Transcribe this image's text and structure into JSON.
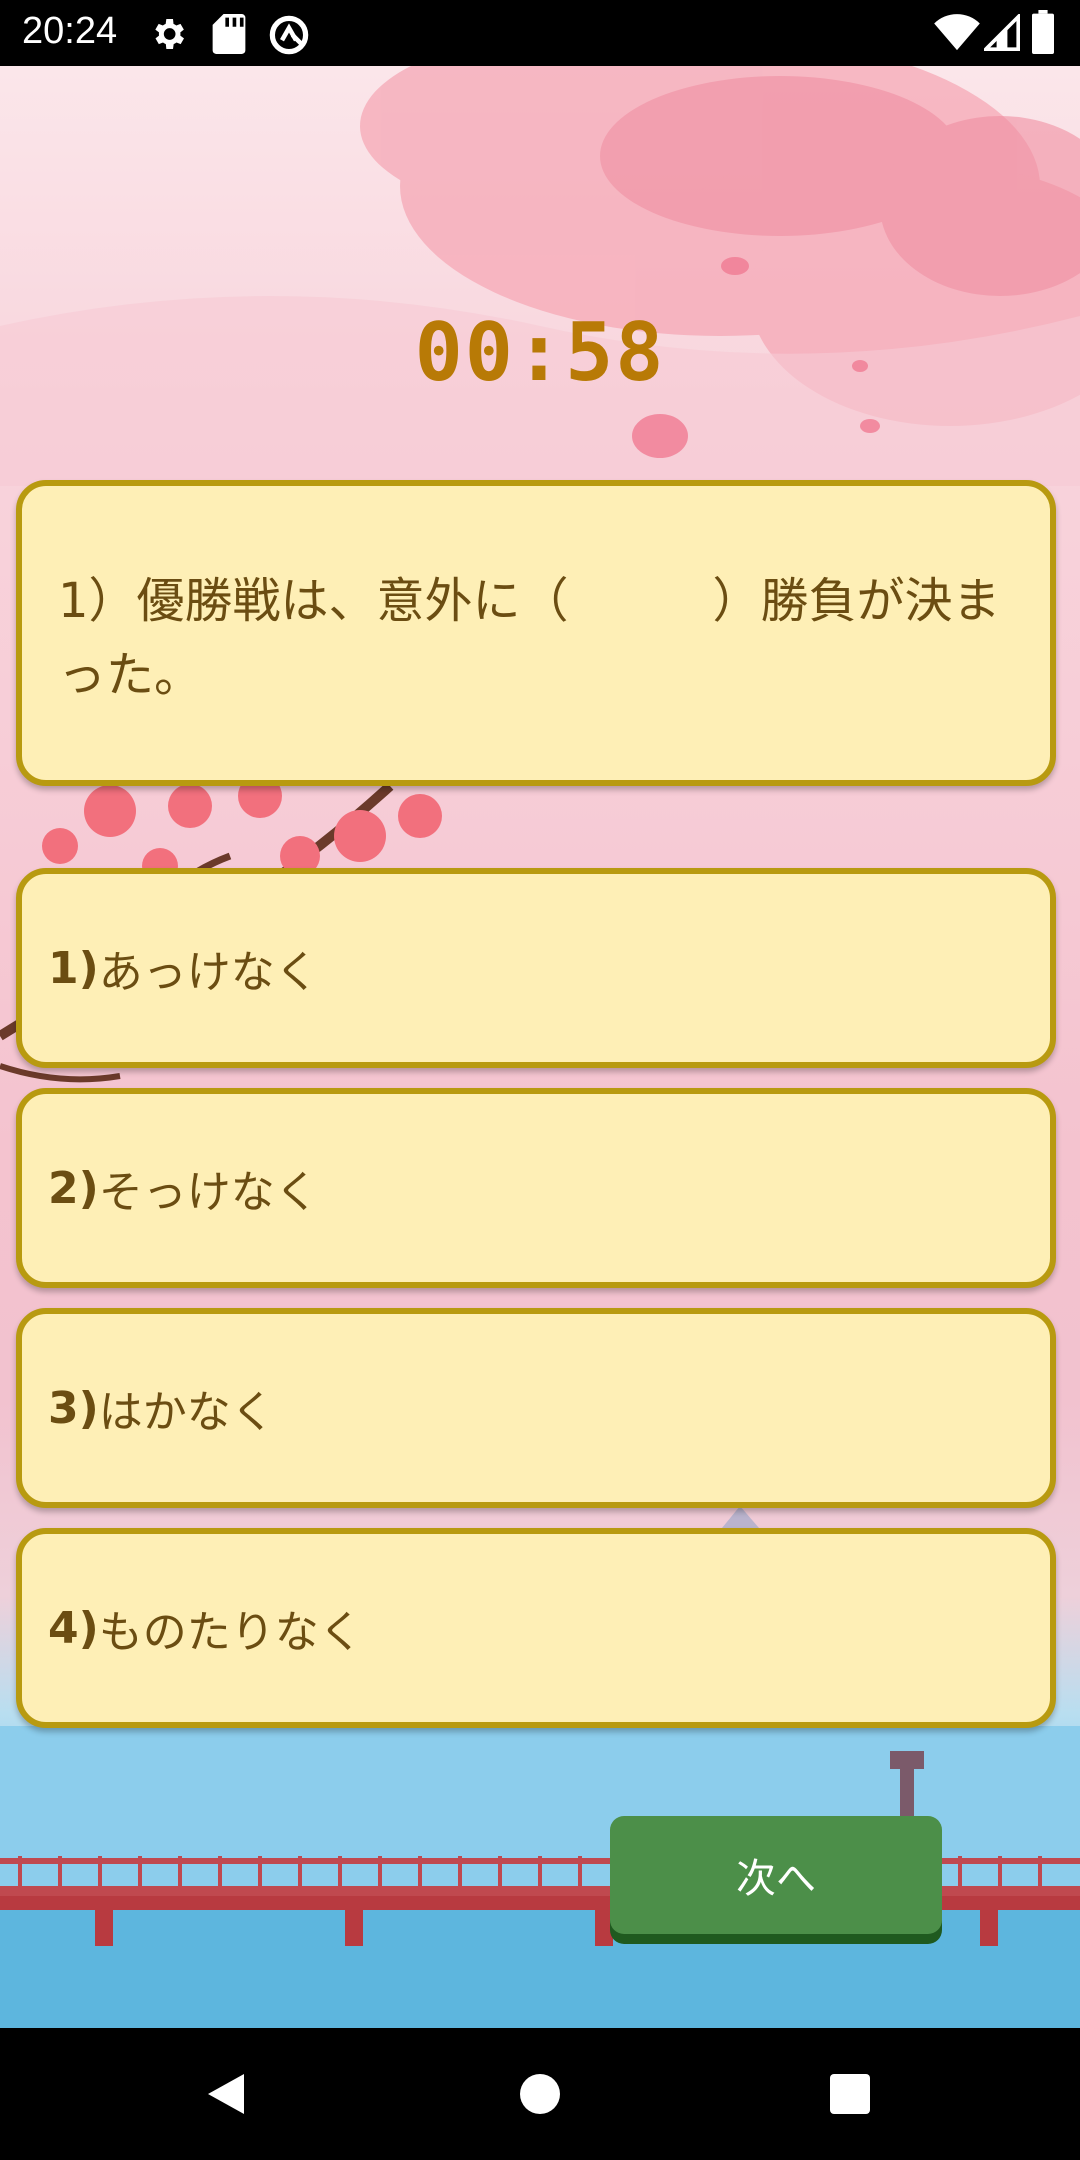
{
  "status_bar": {
    "time": "20:24",
    "icons": [
      "settings-icon",
      "sd-card-icon",
      "vpn-icon",
      "wifi-icon",
      "signal-icon",
      "battery-icon"
    ]
  },
  "quiz": {
    "timer": "00:58",
    "question": "1）優勝戦は、意外に（　　　）勝負が決まった。",
    "options": [
      {
        "num": "1)",
        "text": "あっけなく"
      },
      {
        "num": "2)",
        "text": "そっけなく"
      },
      {
        "num": "3)",
        "text": "はかなく"
      },
      {
        "num": "4)",
        "text": "ものたりなく"
      }
    ],
    "next_label": "次へ"
  },
  "nav_bar": {
    "icons": [
      "back-icon",
      "home-icon",
      "recents-icon"
    ]
  },
  "colors": {
    "timer": "#b87a06",
    "card_bg": "#feefb6",
    "card_border": "#b89a10",
    "button": "#4c8f49"
  }
}
